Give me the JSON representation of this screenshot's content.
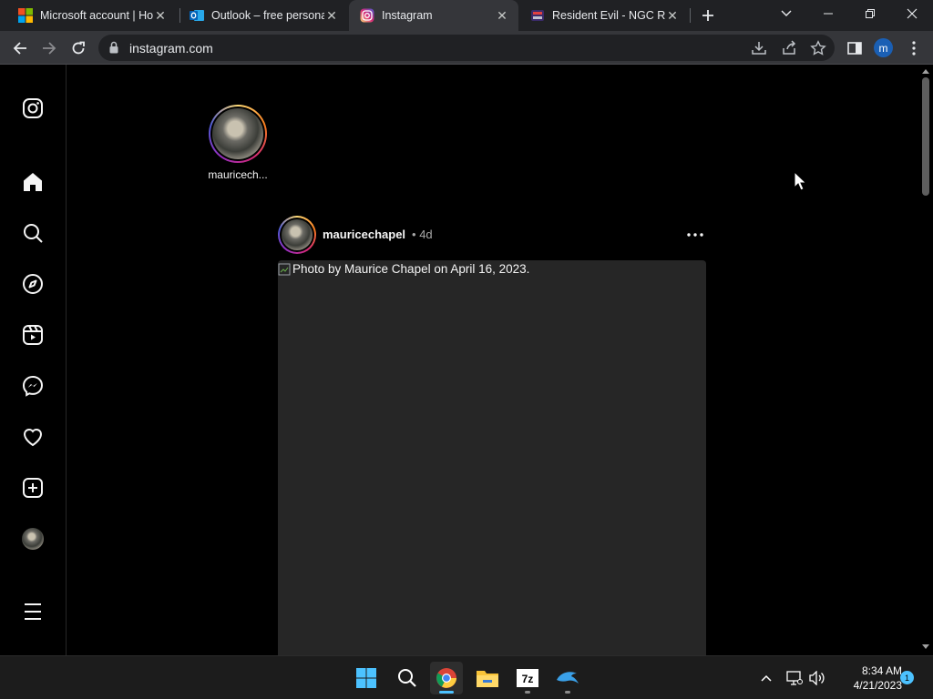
{
  "browser": {
    "tabs": [
      {
        "title": "Microsoft account | Ho",
        "favicon": "microsoft-icon",
        "active": false
      },
      {
        "title": "Outlook – free persona",
        "favicon": "outlook-icon",
        "active": false
      },
      {
        "title": "Instagram",
        "favicon": "instagram-icon",
        "active": true
      },
      {
        "title": "Resident Evil - NGC RO",
        "favicon": "game-site-icon",
        "active": false
      }
    ],
    "url": "instagram.com",
    "profile_initial": "m"
  },
  "instagram": {
    "story": {
      "username": "mauricech..."
    },
    "post": {
      "username": "mauricechapel",
      "separator": "•",
      "time": "4d",
      "image_alt": "Photo by Maurice Chapel on April 16, 2023."
    }
  },
  "taskbar": {
    "time": "8:34 AM",
    "date": "4/21/2023",
    "notification_count": "1"
  },
  "colors": {
    "page_bg": "#000000",
    "media_placeholder": "#262626",
    "browser_frame": "#202124",
    "toolbar": "#35363a",
    "accent": "#4cc2ff"
  }
}
